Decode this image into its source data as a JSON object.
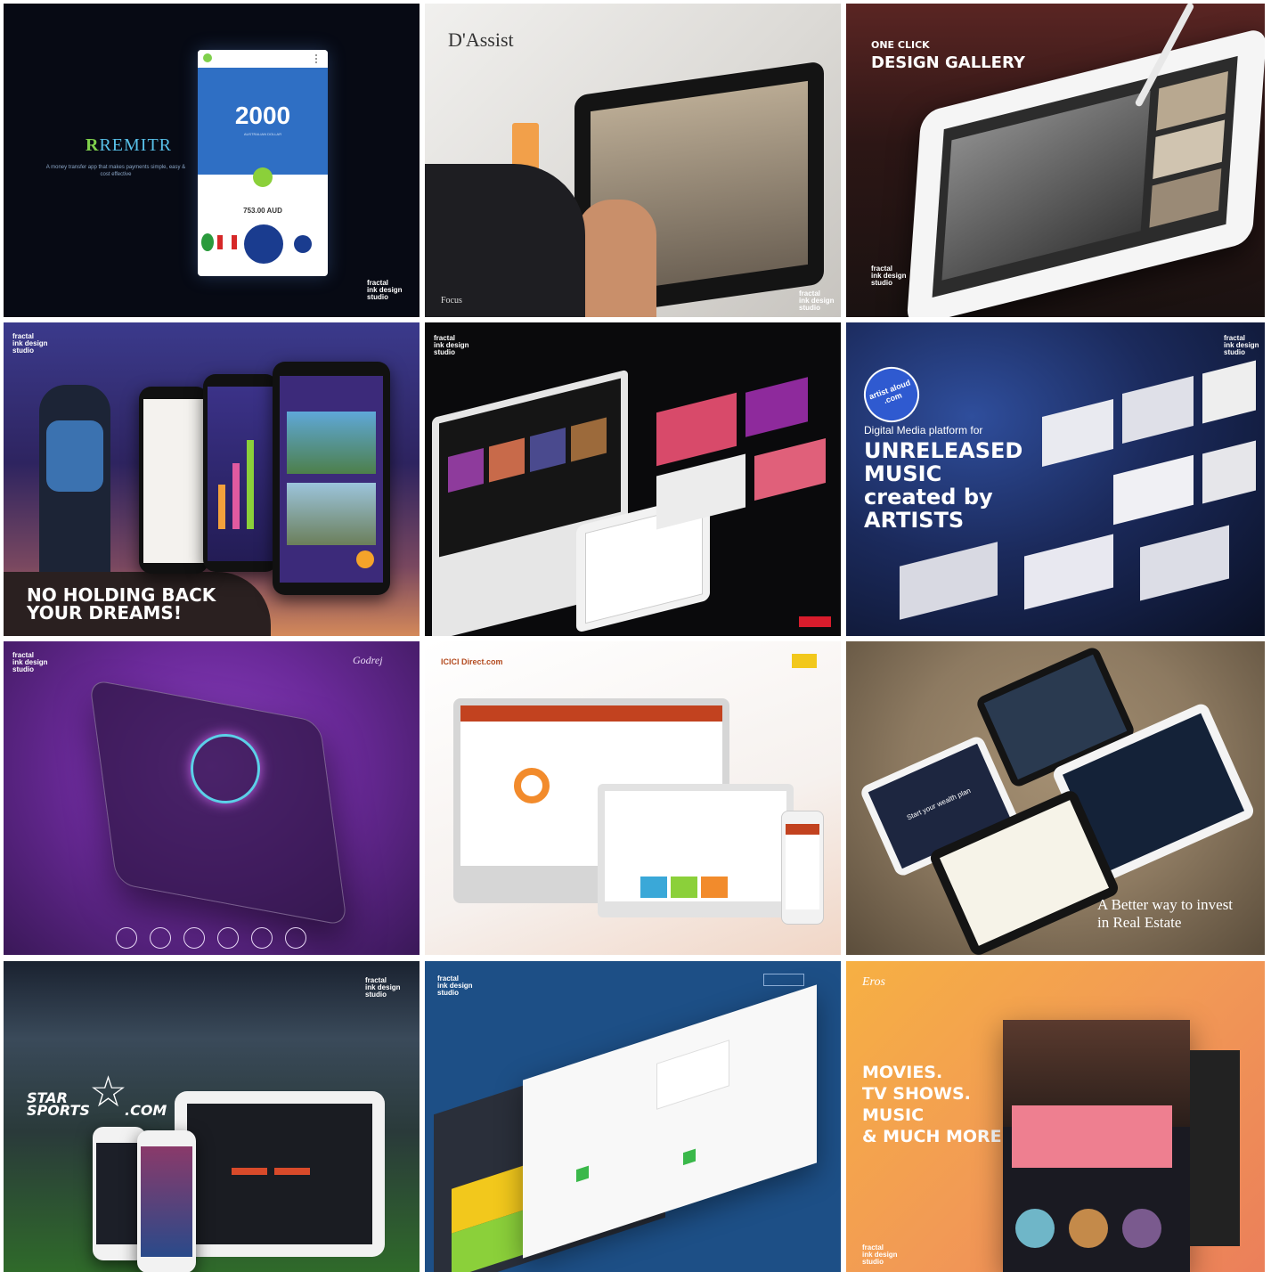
{
  "studio_label": "fractal\nink design\nstudio",
  "tiles": [
    {
      "id": "remitr",
      "brand": "REMITR",
      "tagline": "A money transfer app that makes payments simple, easy & cost effective",
      "amount": "2000",
      "amount_caption": "AUSTRALIAN DOLLAR",
      "converted": "753.00 AUD"
    },
    {
      "id": "dassist",
      "brand": "D'Assist",
      "footer": "Focus"
    },
    {
      "id": "design-gallery",
      "line1": "ONE CLICK",
      "line2": "DESIGN GALLERY"
    },
    {
      "id": "dreams",
      "headline_line1": "NO HOLDING BACK",
      "headline_line2": "YOUR DREAMS!"
    },
    {
      "id": "media-devices"
    },
    {
      "id": "artist-aloud",
      "badge": "artist aloud .com",
      "subtitle": "Digital Media platform for",
      "headline": [
        "UNRELEASED",
        "MUSIC",
        "created by",
        "ARTISTS"
      ]
    },
    {
      "id": "godrej",
      "logo": "Godrej"
    },
    {
      "id": "icici",
      "logo": "ICICI Direct.com"
    },
    {
      "id": "real-estate",
      "tagline_line1": "A Better way to invest",
      "tagline_line2": "in Real Estate",
      "cta": "Start your wealth plan"
    },
    {
      "id": "star-sports",
      "logo_line1": "STAR",
      "logo_line2": "SPORTS",
      "logo_suffix": ".COM"
    },
    {
      "id": "dashboard-blue"
    },
    {
      "id": "eros",
      "logo": "Eros",
      "headline": [
        "MOVIES.",
        "TV SHOWS.",
        "MUSIC",
        "& MUCH MORE"
      ]
    }
  ],
  "colors": {
    "remitr_blue": "#2f6fc4",
    "remitr_green": "#8bd03a",
    "dreams_bg": "#2e2460",
    "artist_bg": "#1b2a5c",
    "godrej_purple": "#6b2a9a",
    "real_estate_stone": "#8d7a61",
    "blue_dash": "#1d4f86",
    "eros_orange": "#f29a55"
  }
}
